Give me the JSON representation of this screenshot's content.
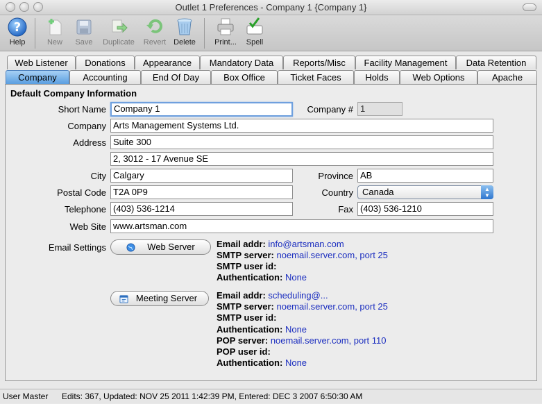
{
  "window": {
    "title": "Outlet 1 Preferences - Company 1 {Company 1}"
  },
  "toolbar": {
    "help": "Help",
    "new": "New",
    "save": "Save",
    "duplicate": "Duplicate",
    "revert": "Revert",
    "delete": "Delete",
    "print": "Print...",
    "spell": "Spell",
    "spell_icon_text": "Spell"
  },
  "tabs_row1": [
    "Web Listener",
    "Donations",
    "Appearance",
    "Mandatory Data",
    "Reports/Misc",
    "Facility Management",
    "Data Retention"
  ],
  "tabs_row2": [
    "Company",
    "Accounting",
    "End Of Day",
    "Box Office",
    "Ticket Faces",
    "Holds",
    "Web Options",
    "Apache"
  ],
  "section_title": "Default Company Information",
  "form": {
    "short_name_label": "Short Name",
    "short_name": "Company 1",
    "company_num_label": "Company #",
    "company_num": "1",
    "company_label": "Company",
    "company": "Arts Management Systems Ltd.",
    "address_label": "Address",
    "address1": "Suite 300",
    "address2": "2, 3012 - 17 Avenue SE",
    "city_label": "City",
    "city": "Calgary",
    "province_label": "Province",
    "province": "AB",
    "postal_label": "Postal Code",
    "postal": "T2A 0P9",
    "country_label": "Country",
    "country": "Canada",
    "telephone_label": "Telephone",
    "telephone": "(403) 536-1214",
    "fax_label": "Fax",
    "fax": "(403) 536-1210",
    "website_label": "Web Site",
    "website": "www.artsman.com"
  },
  "email": {
    "label": "Email Settings",
    "web_server_button": "Web Server",
    "meeting_server_button": "Meeting Server",
    "web": {
      "addr_label": "Email addr:",
      "addr": "info@artsman.com",
      "smtp_label": "SMTP server:",
      "smtp": "noemail.server.com, port 25",
      "user_label": "SMTP user id:",
      "auth_label": "Authentication:",
      "auth": "None"
    },
    "meeting": {
      "addr_label": "Email addr:",
      "addr": "scheduling@...",
      "smtp_label": "SMTP server:",
      "smtp": "noemail.server.com, port 25",
      "user_label": "SMTP user id:",
      "auth_label": "Authentication:",
      "auth": "None",
      "pop_label": "POP server:",
      "pop": "noemail.server.com, port 110",
      "popuser_label": "POP user id:",
      "pop_auth_label": "Authentication:",
      "pop_auth": "None"
    }
  },
  "status": {
    "user": "User Master",
    "edits": "Edits: 367, Updated: NOV 25 2011 1:42:39 PM, Entered: DEC 3 2007 6:50:30 AM"
  }
}
